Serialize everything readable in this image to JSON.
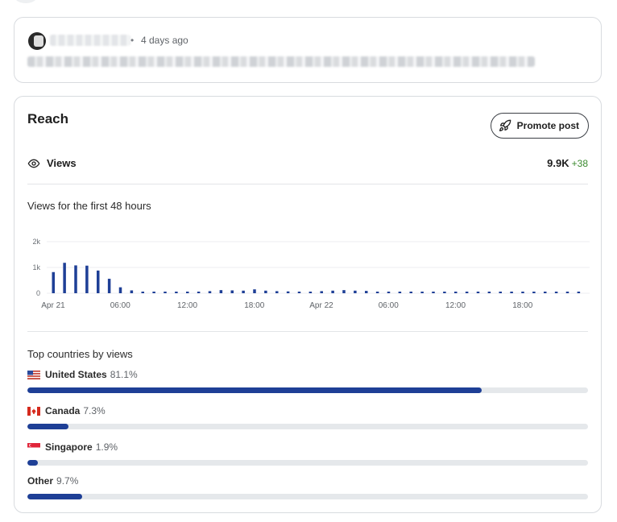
{
  "post": {
    "time_ago": "4 days ago",
    "separator": "•"
  },
  "reach": {
    "title": "Reach",
    "promote_label": "Promote post",
    "views_label": "Views",
    "views_total": "9.9K",
    "views_delta": "+38",
    "chart_title": "Views for the first 48 hours",
    "countries_title": "Top countries by views"
  },
  "countries": [
    {
      "name": "United States",
      "pct_label": "81.1%",
      "fraction": 0.811,
      "flag": "us-flag"
    },
    {
      "name": "Canada",
      "pct_label": "7.3%",
      "fraction": 0.073,
      "flag": "ca-flag"
    },
    {
      "name": "Singapore",
      "pct_label": "1.9%",
      "fraction": 0.019,
      "flag": "sg-flag"
    },
    {
      "name": "Other",
      "pct_label": "9.7%",
      "fraction": 0.097,
      "flag": ""
    }
  ],
  "colors": {
    "bar": "#1e3f96",
    "track": "#e5e8eb",
    "delta": "#3b8a2f"
  },
  "chart_data": {
    "type": "bar",
    "ylim": [
      0,
      2000
    ],
    "y_ticks": [
      {
        "value": 0,
        "label": "0"
      },
      {
        "value": 1000,
        "label": "1k"
      },
      {
        "value": 2000,
        "label": "2k"
      }
    ],
    "x_ticks": [
      {
        "hour": 0,
        "label": "Apr 21"
      },
      {
        "hour": 6,
        "label": "06:00"
      },
      {
        "hour": 12,
        "label": "12:00"
      },
      {
        "hour": 18,
        "label": "18:00"
      },
      {
        "hour": 24,
        "label": "Apr 22"
      },
      {
        "hour": 30,
        "label": "06:00"
      },
      {
        "hour": 36,
        "label": "12:00"
      },
      {
        "hour": 42,
        "label": "18:00"
      }
    ],
    "series": [
      {
        "values": [
          820,
          1180,
          1080,
          1070,
          880,
          560,
          230,
          110,
          50,
          40,
          30,
          40,
          50,
          60,
          80,
          120,
          110,
          100,
          150,
          100,
          80,
          70,
          60,
          60,
          80,
          100,
          120,
          100,
          90,
          60,
          40,
          30,
          20,
          20,
          20,
          20,
          20,
          20,
          20,
          20,
          20,
          20,
          20,
          20,
          20,
          20,
          20,
          20
        ]
      }
    ]
  }
}
